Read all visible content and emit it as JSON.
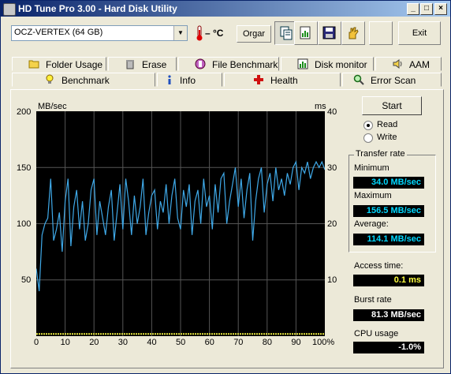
{
  "window": {
    "title": "HD Tune Pro 3.00 - Hard Disk Utility"
  },
  "toolbar": {
    "drive": "OCZ-VERTEX (64 GB)",
    "temperature": "– °C",
    "drive_button": "Orgar",
    "exit_label": "Exit"
  },
  "tabs_top": [
    {
      "label": "Folder Usage",
      "icon": "folder-icon"
    },
    {
      "label": "Erase",
      "icon": "trash-icon"
    },
    {
      "label": "File Benchmark",
      "icon": "file-benchmark-icon"
    },
    {
      "label": "Disk monitor",
      "icon": "chart-icon"
    },
    {
      "label": "AAM",
      "icon": "speaker-icon"
    }
  ],
  "tabs_bottom": [
    {
      "label": "Benchmark",
      "icon": "bulb-icon"
    },
    {
      "label": "Info",
      "icon": "info-icon"
    },
    {
      "label": "Health",
      "icon": "health-cross-icon"
    },
    {
      "label": "Error Scan",
      "icon": "magnifier-icon"
    }
  ],
  "controls": {
    "start_label": "Start",
    "read_label": "Read",
    "write_label": "Write",
    "mode": "Read"
  },
  "stats": {
    "group_title": "Transfer rate",
    "min_label": "Minimum",
    "min_value": "34.0 MB/sec",
    "max_label": "Maximum",
    "max_value": "156.5 MB/sec",
    "avg_label": "Average:",
    "avg_value": "114.1 MB/sec",
    "access_label": "Access time:",
    "access_value": "0.1 ms",
    "burst_label": "Burst rate",
    "burst_value": "81.3 MB/sec",
    "cpu_label": "CPU usage",
    "cpu_value": "-1.0%"
  },
  "colors": {
    "transfer_line": "#3fa9e8",
    "access_line": "#e8e840",
    "plot_bg": "#000000",
    "grid": "#555555"
  },
  "chart_data": {
    "type": "line",
    "ylabel": "MB/sec",
    "y2label": "ms",
    "ylim": [
      0,
      200
    ],
    "y2lim": [
      0,
      40
    ],
    "x_ticks": [
      "0",
      "10",
      "20",
      "30",
      "40",
      "50",
      "60",
      "70",
      "80",
      "90",
      "100%"
    ],
    "y_ticks": [
      "50",
      "100",
      "150",
      "200"
    ],
    "y2_ticks": [
      "10",
      "20",
      "30",
      "40"
    ],
    "series": [
      {
        "x": [
          0,
          1,
          2,
          3,
          4,
          5,
          6,
          7,
          8,
          9,
          10,
          11,
          12,
          13,
          14,
          15,
          16,
          17,
          18,
          19,
          20,
          21,
          22,
          23,
          24,
          25,
          26,
          27,
          28,
          29,
          30,
          31,
          32,
          33,
          34,
          35,
          36,
          37,
          38,
          39,
          40,
          41,
          42,
          43,
          44,
          45,
          46,
          47,
          48,
          49,
          50,
          51,
          52,
          53,
          54,
          55,
          56,
          57,
          58,
          59,
          60,
          61,
          62,
          63,
          64,
          65,
          66,
          67,
          68,
          69,
          70,
          71,
          72,
          73,
          74,
          75,
          76,
          77,
          78,
          79,
          80,
          81,
          82,
          83,
          84,
          85,
          86,
          87,
          88,
          89,
          90,
          91,
          92,
          93,
          94,
          95,
          96,
          97,
          98,
          99,
          100
        ],
        "values": [
          60,
          40,
          90,
          100,
          105,
          140,
          85,
          95,
          110,
          75,
          120,
          140,
          80,
          115,
          130,
          95,
          120,
          85,
          100,
          130,
          140,
          90,
          120,
          105,
          90,
          115,
          130,
          85,
          110,
          135,
          95,
          140,
          120,
          90,
          125,
          100,
          115,
          140,
          90,
          110,
          125,
          130,
          95,
          120,
          110,
          135,
          100,
          125,
          140,
          105,
          95,
          130,
          115,
          135,
          90,
          120,
          130,
          100,
          140,
          115,
          125,
          95,
          135,
          110,
          140,
          145,
          100,
          120,
          135,
          150,
          115,
          140,
          105,
          130,
          145,
          85,
          120,
          140,
          150,
          110,
          135,
          145,
          120,
          150,
          130,
          140,
          125,
          145,
          135,
          150,
          155,
          130,
          150,
          145,
          155,
          140,
          150,
          155,
          150,
          155,
          148
        ]
      },
      {
        "x": [
          0,
          10,
          20,
          30,
          40,
          50,
          60,
          70,
          80,
          90,
          100
        ],
        "values": [
          0.1,
          0.1,
          0.1,
          0.1,
          0.1,
          0.1,
          0.1,
          0.1,
          0.1,
          0.1,
          0.1
        ]
      }
    ]
  }
}
